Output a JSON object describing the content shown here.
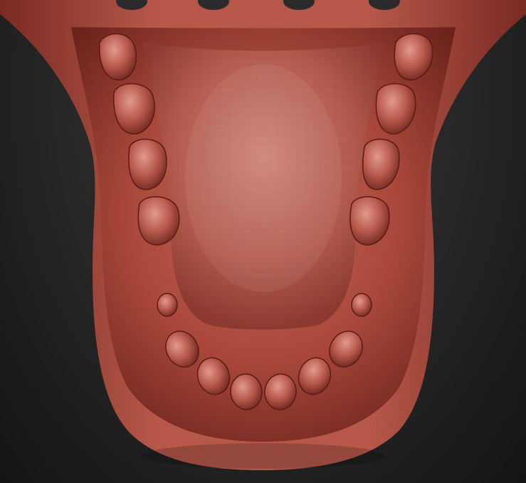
{
  "scene": {
    "subject": "sculpted-lower-jaw-mesh",
    "material_color": "#b04a3c",
    "material_shadow": "#5c1d17",
    "material_highlight": "#d9877a",
    "background_top": "#3a3a3a",
    "background_bottom": "#141414"
  }
}
